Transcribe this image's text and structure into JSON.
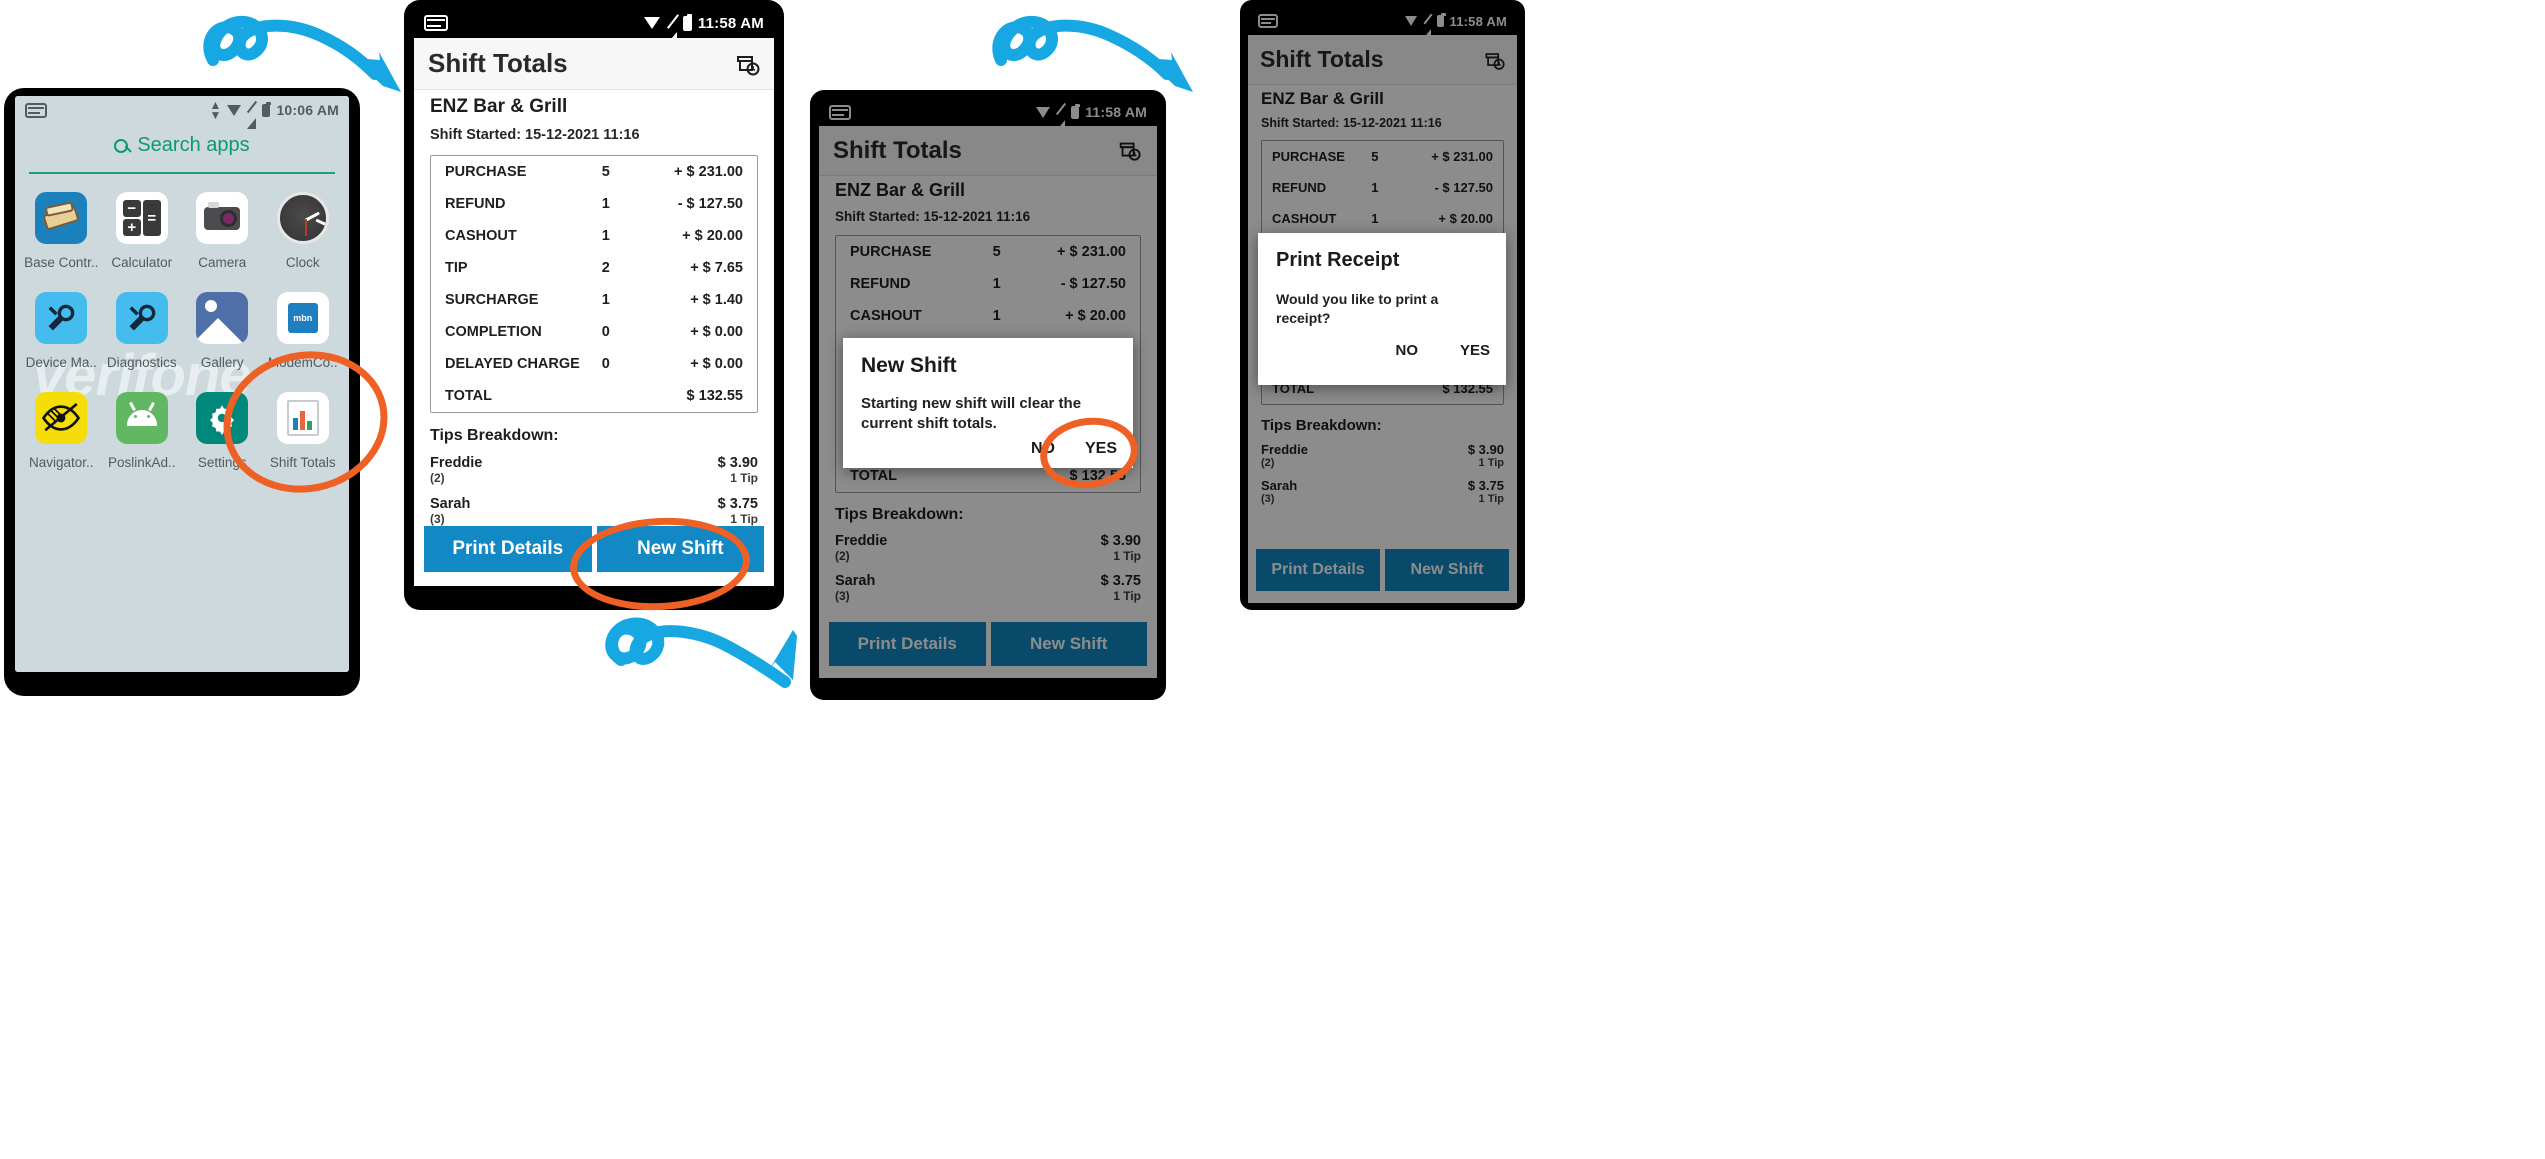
{
  "launcher": {
    "status": {
      "time": "10:06 AM",
      "icons": [
        "card-icon",
        "updown-icon",
        "wifi-icon",
        "signal-off-icon",
        "battery-icon"
      ]
    },
    "search": {
      "label": "Search apps",
      "icon": "search-icon"
    },
    "watermark": "verifone",
    "apps": [
      {
        "label": "Base Contr..",
        "icon": "base-controller-icon"
      },
      {
        "label": "Calculator",
        "icon": "calculator-icon"
      },
      {
        "label": "Camera",
        "icon": "camera-icon"
      },
      {
        "label": "Clock",
        "icon": "clock-icon"
      },
      {
        "label": "Device Ma..",
        "icon": "device-manager-icon"
      },
      {
        "label": "Diagnostics",
        "icon": "diagnostics-icon"
      },
      {
        "label": "Gallery",
        "icon": "gallery-icon"
      },
      {
        "label": "ModemCo..",
        "icon": "modem-config-icon"
      },
      {
        "label": "Navigator..",
        "icon": "navigator-icon"
      },
      {
        "label": "PoslinkAd..",
        "icon": "poslink-admin-icon"
      },
      {
        "label": "Settings",
        "icon": "settings-gear-icon"
      },
      {
        "label": "Shift Totals",
        "icon": "shift-totals-icon"
      }
    ]
  },
  "shift_app": {
    "status": {
      "time": "11:58 AM",
      "icons": [
        "card-icon",
        "wifi-icon",
        "signal-off-icon",
        "battery-icon"
      ]
    },
    "appbar": {
      "title": "Shift Totals",
      "action_icon": "receipt-printer-icon"
    },
    "merchant": "ENZ Bar & Grill",
    "shift_started": "Shift Started: 15-12-2021 11:16",
    "totals": {
      "rows": [
        {
          "label": "PURCHASE",
          "count": "5",
          "amount": "+ $ 231.00"
        },
        {
          "label": "REFUND",
          "count": "1",
          "amount": "- $ 127.50"
        },
        {
          "label": "CASHOUT",
          "count": "1",
          "amount": "+ $ 20.00"
        },
        {
          "label": "TIP",
          "count": "2",
          "amount": "+ $ 7.65"
        },
        {
          "label": "SURCHARGE",
          "count": "1",
          "amount": "+ $ 1.40"
        },
        {
          "label": "COMPLETION",
          "count": "0",
          "amount": "+ $ 0.00"
        },
        {
          "label": "DELAYED CHARGE",
          "count": "0",
          "amount": "+ $ 0.00"
        }
      ],
      "total": {
        "label": "TOTAL",
        "count": "",
        "amount": "$ 132.55"
      }
    },
    "tips": {
      "title": "Tips Breakdown:",
      "entries": [
        {
          "name": "Freddie",
          "sub": "(2)",
          "amount": "$ 3.90",
          "count": "1 Tip"
        },
        {
          "name": "Sarah",
          "sub": "(3)",
          "amount": "$ 3.75",
          "count": "1 Tip"
        }
      ]
    },
    "buttons": {
      "print": "Print Details",
      "new_shift": "New Shift"
    }
  },
  "new_shift_dialog": {
    "title": "New Shift",
    "message": "Starting new shift will clear the current shift totals.",
    "no": "NO",
    "yes": "YES"
  },
  "print_receipt_dialog": {
    "title": "Print Receipt",
    "message": "Would you like to print a receipt?",
    "no": "NO",
    "yes": "YES"
  },
  "annotations": {
    "arrow_color": "#17a8e3",
    "highlight_color": "#ef6024",
    "marks": [
      {
        "name": "arrow-launcher-to-shift",
        "type": "curly-arrow"
      },
      {
        "name": "arrow-shift-to-newshift",
        "type": "curly-arrow"
      },
      {
        "name": "arrow-newshift-to-print",
        "type": "curly-arrow"
      },
      {
        "name": "circle-shift-totals-app",
        "type": "oval"
      },
      {
        "name": "circle-new-shift-button",
        "type": "oval"
      },
      {
        "name": "circle-yes-button",
        "type": "oval"
      }
    ]
  }
}
